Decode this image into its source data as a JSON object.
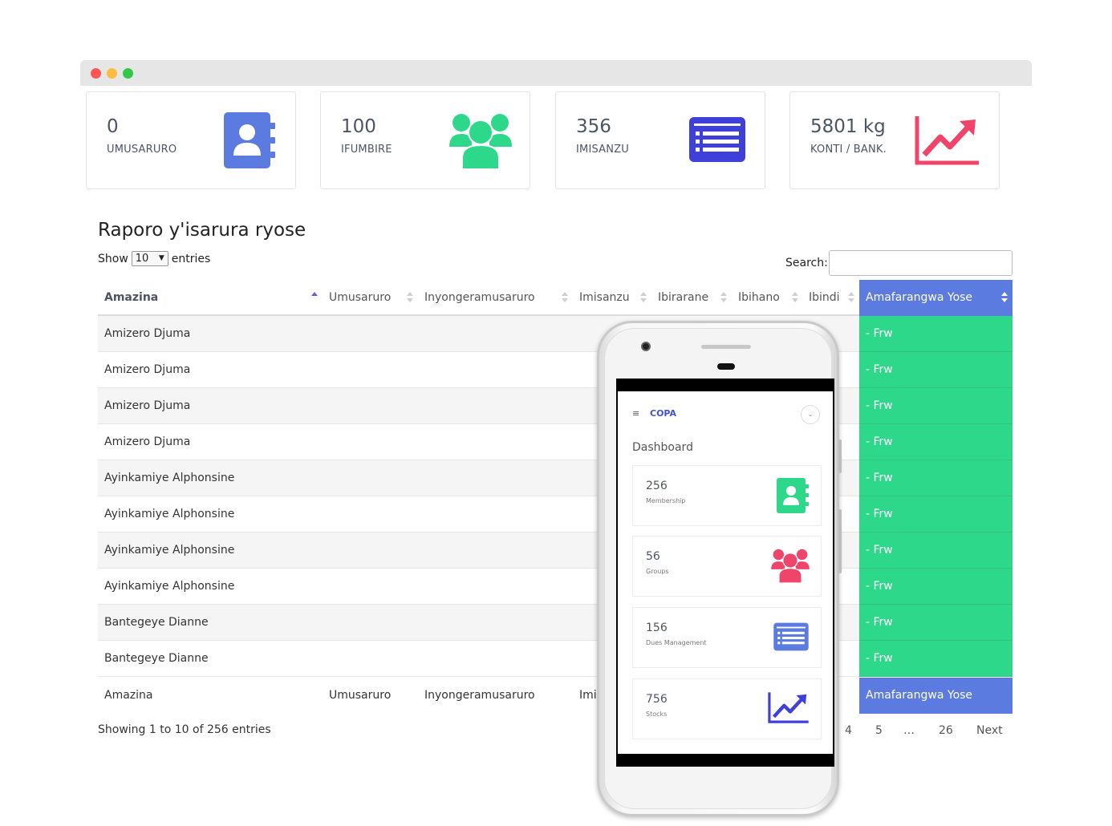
{
  "stats": [
    {
      "value": "0",
      "label": "UMUSARURO",
      "icon": "contact-book-icon",
      "color": "#5b7be0"
    },
    {
      "value": "100",
      "label": "IFUMBIRE",
      "icon": "users-group-icon",
      "color": "#2ed88a"
    },
    {
      "value": "356",
      "label": "IMISANZU",
      "icon": "list-icon",
      "color": "#3f3fd9"
    },
    {
      "value": "5801 kg",
      "label": "KONTI / BANK.",
      "icon": "trending-up-icon",
      "color": "#f0456a"
    }
  ],
  "report": {
    "title": "Raporo y'isarura ryose",
    "show_label": "Show",
    "entries_value": "10",
    "entries_label": "entries",
    "search_label": "Search:",
    "search_value": ""
  },
  "table": {
    "columns": [
      "Amazina",
      "Umusaruro",
      "Inyongeramusaruro",
      "Imisanzu",
      "Ibirarane",
      "Ibihano",
      "Ibindi",
      "Amafarangwa Yose"
    ],
    "rows": [
      {
        "name": "Amizero Djuma",
        "total": "- Frw"
      },
      {
        "name": "Amizero Djuma",
        "total": "- Frw"
      },
      {
        "name": "Amizero Djuma",
        "total": "- Frw"
      },
      {
        "name": "Amizero Djuma",
        "total": "- Frw"
      },
      {
        "name": "Ayinkamiye Alphonsine",
        "total": "- Frw"
      },
      {
        "name": "Ayinkamiye Alphonsine",
        "total": "- Frw"
      },
      {
        "name": "Ayinkamiye Alphonsine",
        "total": "- Frw"
      },
      {
        "name": "Ayinkamiye Alphonsine",
        "total": "- Frw"
      },
      {
        "name": "Bantegeye Dianne",
        "total": "- Frw"
      },
      {
        "name": "Bantegeye Dianne",
        "total": "- Frw"
      }
    ],
    "footer": [
      "Amazina",
      "Umusaruro",
      "Inyongeramusaruro",
      "Imis",
      "Amafarangwa Yose"
    ],
    "info": "Showing 1 to 10 of 256 entries",
    "pagination": [
      "4",
      "5",
      "…",
      "26",
      "Next"
    ]
  },
  "phone": {
    "brand": "COPA",
    "menu_icon": "≡",
    "user_icon": "⌄",
    "page_title": "Dashboard",
    "cards": [
      {
        "value": "256",
        "label": "Membership",
        "icon": "contact-book-icon",
        "color": "#2ed88a"
      },
      {
        "value": "56",
        "label": "Groups",
        "icon": "users-group-icon",
        "color": "#f0456a"
      },
      {
        "value": "156",
        "label": "Dues Management",
        "icon": "list-icon",
        "color": "#5b7be0"
      },
      {
        "value": "756",
        "label": "Stocks",
        "icon": "trending-up-icon",
        "color": "#3f3fd9"
      }
    ]
  }
}
